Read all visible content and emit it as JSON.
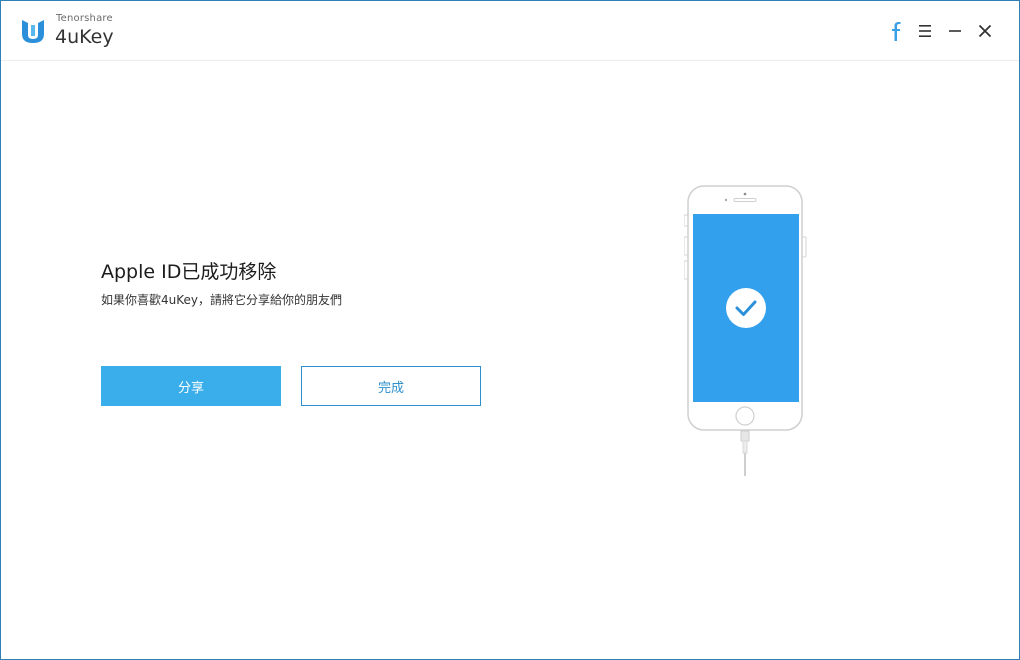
{
  "app": {
    "vendor": "Tenorshare",
    "name": "4uKey"
  },
  "titlebar": {
    "icons": [
      "facebook-icon",
      "menu-icon",
      "minimize-icon",
      "close-icon"
    ]
  },
  "main": {
    "title": "Apple ID已成功移除",
    "subtitle": "如果你喜歡4uKey，請將它分享給你的朋友們",
    "share_label": "分享",
    "done_label": "完成"
  },
  "illustration": {
    "icon": "check-circle-icon"
  },
  "colors": {
    "accent": "#3aaeea",
    "screen": "#33a0ed",
    "brand": "#2b90d9"
  }
}
